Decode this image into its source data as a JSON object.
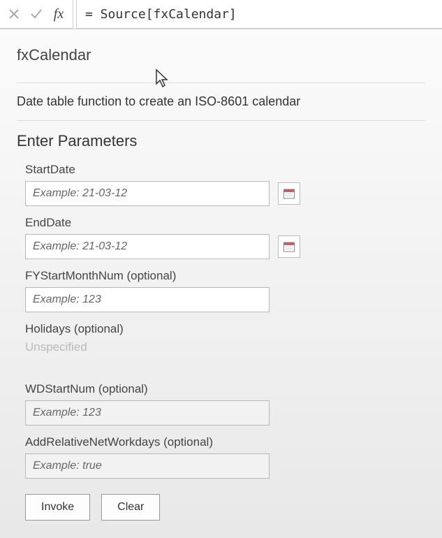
{
  "formula_bar": {
    "expression": "= Source[fxCalendar]"
  },
  "function": {
    "name": "fxCalendar",
    "description": "Date table function to create an ISO-8601 calendar"
  },
  "section": {
    "enter_parameters": "Enter Parameters"
  },
  "params": {
    "start_date": {
      "label": "StartDate",
      "placeholder": "Example: 21-03-12"
    },
    "end_date": {
      "label": "EndDate",
      "placeholder": "Example: 21-03-12"
    },
    "fy_start_month": {
      "label": "FYStartMonthNum (optional)",
      "placeholder": "Example: 123"
    },
    "holidays": {
      "label": "Holidays (optional)",
      "unspecified": "Unspecified"
    },
    "wd_start_num": {
      "label": "WDStartNum (optional)",
      "placeholder": "Example: 123"
    },
    "add_rel_workdays": {
      "label": "AddRelativeNetWorkdays (optional)",
      "placeholder": "Example: true"
    }
  },
  "buttons": {
    "invoke": "Invoke",
    "clear": "Clear"
  }
}
